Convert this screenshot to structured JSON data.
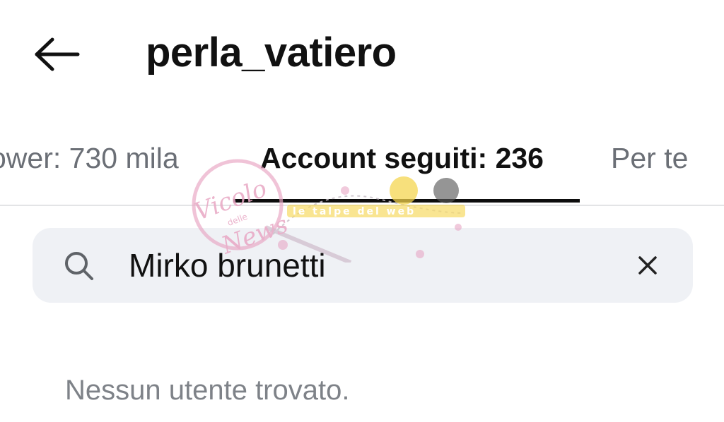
{
  "header": {
    "back_icon": "arrow-left-icon",
    "username": "perla_vatiero"
  },
  "tabs": {
    "followers_label": "ower: 730 mila",
    "following_label": "Account seguiti: 236",
    "foryou_label": "Per te",
    "active": "following"
  },
  "search": {
    "icon": "search-icon",
    "value": "Mirko brunetti",
    "clear_icon": "close-icon"
  },
  "results": {
    "empty_message": "Nessun utente trovato."
  },
  "watermark": {
    "text_main": "Vicolo",
    "text_small": "delle",
    "text_bottom": "News",
    "text_tagline": "le talpe del web"
  },
  "colors": {
    "text_primary": "#111111",
    "text_secondary": "#6b6f76",
    "search_bg": "#eff1f5",
    "divider": "#e3e4e6",
    "watermark_pink": "#e8a7c4",
    "watermark_yellow": "#f5d44a"
  }
}
